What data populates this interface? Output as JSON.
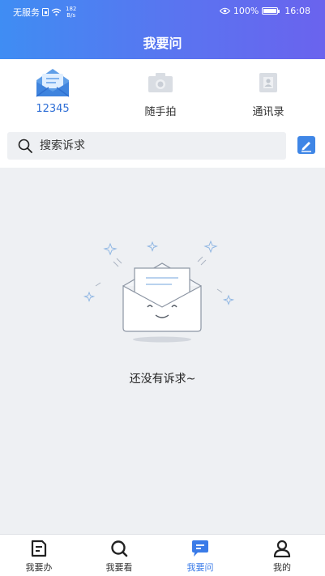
{
  "status_bar": {
    "carrier": "无服务",
    "net_speed_value": "182",
    "net_speed_unit": "B/s",
    "battery": "100%",
    "time": "16:08"
  },
  "header": {
    "title": "我要问"
  },
  "quick_actions": [
    {
      "label": "12345",
      "icon": "envelope-icon",
      "active": true
    },
    {
      "label": "随手拍",
      "icon": "camera-icon",
      "active": false
    },
    {
      "label": "通讯录",
      "icon": "contacts-icon",
      "active": false
    }
  ],
  "search": {
    "placeholder": "搜索诉求"
  },
  "empty_state": {
    "message": "还没有诉求~"
  },
  "bottom_nav": [
    {
      "label": "我要办",
      "icon": "document-icon",
      "active": false
    },
    {
      "label": "我要看",
      "icon": "search-icon",
      "active": false
    },
    {
      "label": "我要问",
      "icon": "chat-icon",
      "active": true
    },
    {
      "label": "我的",
      "icon": "user-icon",
      "active": false
    }
  ],
  "colors": {
    "header_gradient_start": "#3f8df3",
    "header_gradient_end": "#6a63ee",
    "accent": "#3a7be8",
    "background": "#eef0f3"
  }
}
